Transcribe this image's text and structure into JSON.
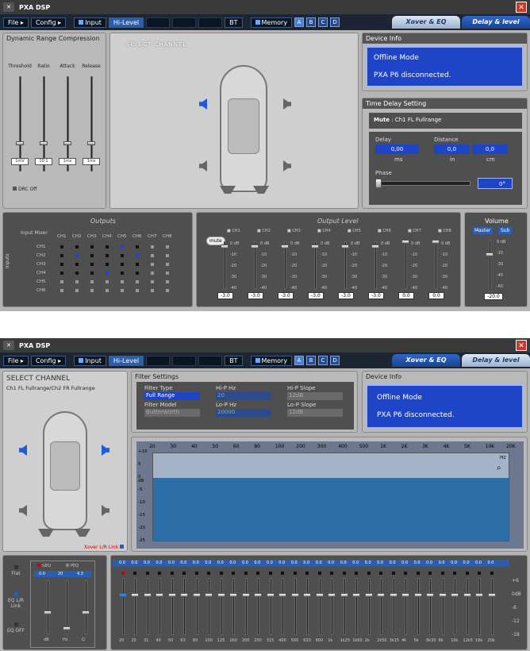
{
  "window1": {
    "title": "PXA DSP",
    "menu": {
      "file": "File",
      "config": "Config",
      "input": "Input",
      "hilevel": "Hi-Level",
      "memory": "Memory",
      "mem_a": "A",
      "mem_b": "B",
      "mem_c": "C",
      "mem_d": "D",
      "bt": "BT"
    },
    "tabs": {
      "xover": "Xover & EQ",
      "delay": "Delay & level"
    },
    "drc": {
      "title": "Dynamic Range Compression",
      "labels": [
        "Threshold",
        "Ratio",
        "Attack",
        "Release"
      ],
      "values": [
        "1mV",
        "10:1",
        "1ms",
        "1ms"
      ],
      "off": "DRC Off"
    },
    "select": "SELECT CHANNEL",
    "device": {
      "title": "Device Info",
      "line1": "Offline Mode",
      "line2": "PXA P6 disconnected."
    },
    "delay": {
      "title": "Time Delay Setting",
      "mute_label": "Mute",
      "channel": "Ch1  FL Fullrange",
      "delay_label": "Delay",
      "distance_label": "Distance",
      "delay_val": "0,00",
      "dist_in": "0,0",
      "dist_cm": "0,0",
      "unit_ms": "ms",
      "unit_in": "in",
      "unit_cm": "cm",
      "phase_label": "Phase",
      "phase_val": "0°"
    },
    "outputs_title": "Outputs",
    "input_mixer": "Input Mixer",
    "inputs": "Inputs",
    "out_cols": [
      "CH1",
      "CH2",
      "CH3",
      "CH4",
      "CH5",
      "CH6",
      "CH7",
      "CH8"
    ],
    "in_rows": [
      "CH1",
      "CH2",
      "CH3",
      "CH4",
      "CH5",
      "CH6"
    ],
    "level_title": "Output Level",
    "mute": "mute",
    "level_ch": [
      "CH1",
      "CH2",
      "CH3",
      "CH4",
      "CH5",
      "CH6",
      "CH7",
      "CH8"
    ],
    "level_scale": [
      "0 dB",
      "-10",
      "-20",
      "-30",
      "-40"
    ],
    "level_vals": [
      "-3.0",
      "-3.0",
      "-3.0",
      "-3.0",
      "-3.0",
      "-3.0",
      "0.0",
      "0.0"
    ],
    "volume": {
      "title": "Volume",
      "master": "Master",
      "sub": "Sub",
      "scale": [
        "0 dB",
        "-15",
        "-30",
        "-45",
        "-60"
      ],
      "val": "-20.0"
    }
  },
  "window2": {
    "title": "PXA DSP",
    "select": "SELECT CHANNEL",
    "channel": "Ch1  FL Fullrange/Ch2  FR Fullrange",
    "xlink": "Xover L/R Link",
    "filter": {
      "title": "Filter Settings",
      "type_label": "Filter Type",
      "type_val": "Full Range",
      "model_label": "Filter Model",
      "model_val": "Butterworth",
      "hip_label": "Hi-P Hz",
      "hip_val": "20",
      "lop_label": "Lo-P Hz",
      "lop_val": "20000",
      "hips_label": "Hi-P Slope",
      "hips_val": "12dB",
      "lops_label": "Lo-P Slope",
      "lops_val": "12dB"
    },
    "device": {
      "title": "Device Info",
      "line1": "Offline Mode",
      "line2": "PXA P6 disconnected."
    },
    "graph": {
      "xticks": [
        "20",
        "30",
        "40",
        "50",
        "60",
        "80",
        "100",
        "200",
        "300",
        "400",
        "500",
        "1K",
        "2K",
        "3K",
        "4K",
        "5K",
        "10K",
        "20K"
      ],
      "xunit": "Hz",
      "yticks": [
        "+10",
        "5",
        "0",
        "-5",
        "-10",
        "-15",
        "-20",
        "-25"
      ],
      "yunit": "dB"
    },
    "eq": {
      "flat": "Flat",
      "link": "EQ L/R Link",
      "off": "EQ OFF",
      "geq": "GEQ",
      "peq": "PEQ",
      "mini_vals": [
        "0.0",
        "20",
        "4.3"
      ],
      "mini_units": [
        "dB",
        "Hz",
        "Q"
      ],
      "scale": [
        "+6",
        "0dB",
        "-6",
        "-12",
        "-18"
      ],
      "freqs": [
        "20",
        "25",
        "31",
        "40",
        "50",
        "63",
        "80",
        "100",
        "125",
        "160",
        "200",
        "250",
        "315",
        "400",
        "500",
        "630",
        "800",
        "1k",
        "1k25",
        "1k60",
        "2k",
        "2k50",
        "3k15",
        "4k",
        "5k",
        "6k30",
        "8k",
        "10k",
        "12k5",
        "16k",
        "20k"
      ],
      "gain": "0.0"
    }
  }
}
